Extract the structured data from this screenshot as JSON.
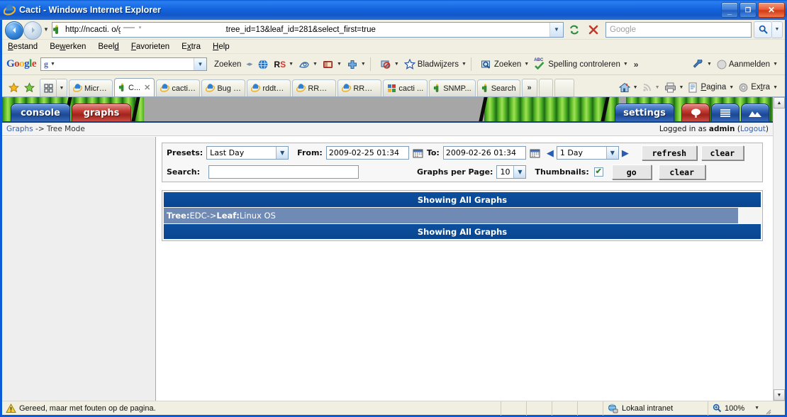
{
  "window": {
    "title": "Cacti - Windows Internet Explorer",
    "minimize_label": "–",
    "maximize_label": "❐",
    "close_label": "✕"
  },
  "nav": {
    "back_label": "◄",
    "forward_label": "►",
    "history_caret": "▼",
    "url": "http://ncacti.                          o/graph_view.php?action=tree&tree_id=13&leaf_id=281&select_first=true",
    "url_dropdown": "▼",
    "refresh_label": "refresh-icon",
    "stop_label": "✕",
    "search_placeholder": "Google",
    "search_value": "",
    "search_go": "search-icon",
    "search_caret": "▼"
  },
  "menubar": {
    "items": [
      "Bestand",
      "Bewerken",
      "Beeld",
      "Favorieten",
      "Extra",
      "Help"
    ]
  },
  "google_toolbar": {
    "logo": "Google",
    "input_value": "",
    "input_prefix": "g",
    "search_label": "Zoeken",
    "items": [
      {
        "name": "translate-icon",
        "label": ""
      },
      {
        "name": "rs-icon",
        "label": "RS"
      },
      {
        "name": "highlight-icon",
        "label": ""
      },
      {
        "name": "notebook-icon",
        "label": ""
      },
      {
        "name": "add-icon",
        "label": ""
      },
      {
        "name": "popup-blocker-icon",
        "label": ""
      },
      {
        "name": "bookmarks-icon",
        "label": "Bladwijzers"
      },
      {
        "name": "site-search-icon",
        "label": "Zoeken"
      },
      {
        "name": "spellcheck-icon",
        "label": "Spelling controleren"
      }
    ],
    "overflow": "»",
    "settings_label": "",
    "signin_label": "Aanmelden"
  },
  "tabbar": {
    "favorites_star": "favorites-star-icon",
    "add_favorite": "add-favorite-icon",
    "quick_tabs": "quick-tabs-icon",
    "tab_list_caret": "▼",
    "tabs": [
      {
        "label": "Micro...",
        "icon": "ie-icon",
        "active": false,
        "closable": false
      },
      {
        "label": "C...",
        "icon": "cacti-icon",
        "active": true,
        "closable": true
      },
      {
        "label": "cacti ...",
        "icon": "ie-icon",
        "active": false,
        "closable": false
      },
      {
        "label": "Bug 2...",
        "icon": "ie-icon",
        "active": false,
        "closable": false
      },
      {
        "label": "rddto...",
        "icon": "ie-icon",
        "active": false,
        "closable": false
      },
      {
        "label": "RRDt...",
        "icon": "ie-icon",
        "active": false,
        "closable": false
      },
      {
        "label": "RRDt...",
        "icon": "ie-icon",
        "active": false,
        "closable": false
      },
      {
        "label": "cacti ...",
        "icon": "google-icon",
        "active": false,
        "closable": false
      },
      {
        "label": "SNMP...",
        "icon": "cacti-icon",
        "active": false,
        "closable": false
      },
      {
        "label": "Search",
        "icon": "cacti-icon",
        "active": false,
        "closable": false
      }
    ],
    "more": "»",
    "right_items": [
      {
        "name": "home-icon",
        "label": ""
      },
      {
        "name": "feeds-icon",
        "label": ""
      },
      {
        "name": "print-icon",
        "label": ""
      },
      {
        "name": "page-menu",
        "label": "Pagina"
      },
      {
        "name": "tools-menu",
        "label": "Extra"
      }
    ],
    "right_chevron": "»"
  },
  "cacti": {
    "tabs": [
      {
        "label": "console",
        "color": "blue"
      },
      {
        "label": "graphs",
        "color": "red"
      }
    ],
    "right_tabs": [
      {
        "label": "settings",
        "color": "blue",
        "icon": ""
      },
      {
        "label": "",
        "color": "red",
        "icon": "tree-icon"
      },
      {
        "label": "",
        "color": "blue",
        "icon": "list-icon"
      },
      {
        "label": "",
        "color": "blue",
        "icon": "preview-icon"
      }
    ],
    "breadcrumb_link": "Graphs",
    "breadcrumb_sep": " -> ",
    "breadcrumb_current": "Tree Mode",
    "logged_in_prefix": "Logged in as ",
    "logged_in_user": "admin",
    "logout_open": " (",
    "logout_label": "Logout",
    "logout_close": ")"
  },
  "filter": {
    "presets_label": "Presets:",
    "presets_value": "Last Day",
    "from_label": "From:",
    "from_value": "2009-02-25 01:34",
    "to_label": "To:",
    "to_value": "2009-02-26 01:34",
    "calendar_icon": "calendar-icon",
    "prev_arrow": "◀",
    "span_value": "1 Day",
    "next_arrow": "▶",
    "refresh_button": "refresh",
    "clear_button": "clear",
    "search_label": "Search:",
    "search_value": "",
    "graphs_per_page_label": "Graphs per Page:",
    "graphs_per_page_value": "10",
    "thumbnails_label": "Thumbnails:",
    "thumbnails_checked": "✔",
    "go_button": "go",
    "clear_button2": "clear"
  },
  "results": {
    "header_top": "Showing All Graphs",
    "header_bottom": "Showing All Graphs",
    "tree_label": "Tree:",
    "tree_value": " EDC-> ",
    "leaf_label": "Leaf:",
    "leaf_value": " Linux OS"
  },
  "statusbar": {
    "message": "Gereed, maar met fouten op de pagina.",
    "zone": "Lokaal intranet",
    "zoom": "100%",
    "zoom_caret": "▼"
  },
  "colors": {
    "title_blue": "#1464e0",
    "cacti_blue": "#0a4590",
    "tree_row": "#6f8ab4",
    "accent_green": "#6ec62f"
  }
}
